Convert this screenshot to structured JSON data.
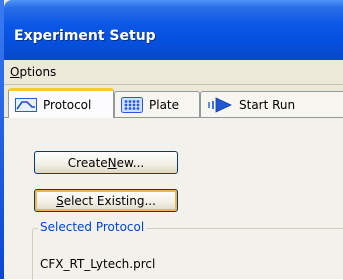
{
  "window": {
    "title": "Experiment Setup"
  },
  "menu": {
    "options_label": "Options",
    "options_mnemonic": "O",
    "options_rest": "ptions"
  },
  "tabs": [
    {
      "label": "Protocol",
      "icon": "protocol-wave-icon",
      "active": true
    },
    {
      "label": "Plate",
      "icon": "plate-grid-icon",
      "active": false
    },
    {
      "label": "Start Run",
      "icon": "start-run-arrow-icon",
      "active": false
    }
  ],
  "protocol_panel": {
    "create_new": {
      "label": "Create New...",
      "pre": "Create ",
      "mnemonic": "N",
      "post": "ew..."
    },
    "select_existing": {
      "label": "Select Existing...",
      "mnemonic": "S",
      "post": "elect Existing..."
    },
    "selected_group_label": "Selected Protocol",
    "selected_file": "CFX_RT_Lytech.prcl"
  },
  "colors": {
    "titlebar": "#0a58e0",
    "tab_highlight": "#ffc83c",
    "group_label": "#0046d5",
    "focus_ring": "#f7b548"
  }
}
